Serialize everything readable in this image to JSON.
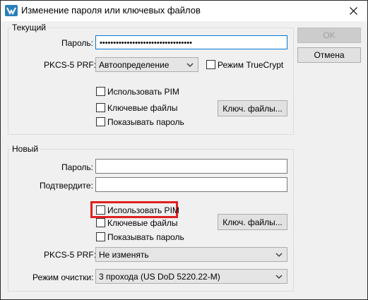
{
  "window": {
    "title": "Изменение пароля или ключевых файлов"
  },
  "current": {
    "group_title": "Текущий",
    "password_label": "Пароль:",
    "password_value": "••••••••••••••••••••••••••••••••••",
    "prf_label": "PKCS-5 PRF:",
    "prf_value": "Автоопределение",
    "truecrypt_label": "Режим TrueCrypt",
    "truecrypt_checked": false,
    "use_pim_label": "Использовать PIM",
    "keyfiles_label": "Ключевые файлы",
    "show_password_label": "Показывать пароль",
    "keyfiles_button": "Ключ. файлы..."
  },
  "new": {
    "group_title": "Новый",
    "password_label": "Пароль:",
    "password_value": "",
    "confirm_label": "Подтвердите:",
    "confirm_value": "",
    "use_pim_label": "Использовать PIM",
    "keyfiles_label": "Ключевые файлы",
    "show_password_label": "Показывать пароль",
    "keyfiles_button": "Ключ. файлы...",
    "prf_label": "PKCS-5 PRF:",
    "prf_value": "Не изменять",
    "wipe_label": "Режим очистки:",
    "wipe_value": "3 прохода (US DoD 5220.22-M)"
  },
  "buttons": {
    "ok": "OK",
    "cancel": "Отмена"
  },
  "colors": {
    "highlight": "#e02020",
    "focus": "#0078d7"
  }
}
